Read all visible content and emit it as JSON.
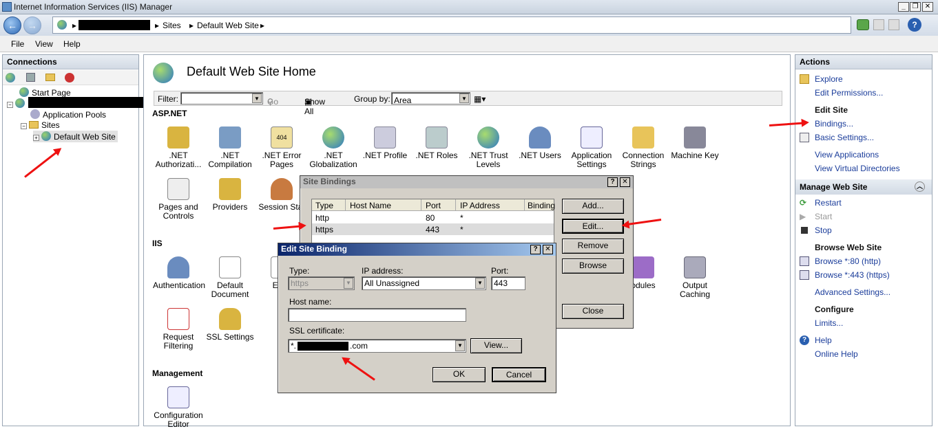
{
  "window": {
    "title": "Internet Information Services (IIS) Manager"
  },
  "address": {
    "segments": [
      "Sites",
      "Default Web Site"
    ]
  },
  "menu": [
    "File",
    "View",
    "Help"
  ],
  "connections": {
    "header": "Connections",
    "start_page": "Start Page",
    "app_pools": "Application Pools",
    "sites": "Sites",
    "default_site": "Default Web Site"
  },
  "main": {
    "title": "Default Web Site Home",
    "filter": {
      "label": "Filter:",
      "go": "Go",
      "show_all": "Show All",
      "group_by": "Group by:",
      "group_value": "Area"
    },
    "sections": {
      "aspnet": "ASP.NET",
      "iis": "IIS",
      "management": "Management"
    },
    "aspnet_features": [
      ".NET Authorizati...",
      ".NET Compilation",
      ".NET Error Pages",
      ".NET Globalization",
      ".NET Profile",
      ".NET Roles",
      ".NET Trust Levels",
      ".NET Users",
      "Application Settings",
      "Connection Strings",
      "Machine Key"
    ],
    "aspnet_row2": [
      "Pages and Controls",
      "Providers",
      "Session Stat"
    ],
    "iis_features": [
      "Authentication",
      "Default Document",
      "Error",
      "odules",
      "Output Caching"
    ],
    "iis_row2": [
      "Request Filtering",
      "SSL Settings"
    ],
    "management_features": [
      "Configuration Editor"
    ]
  },
  "site_bindings": {
    "title": "Site Bindings",
    "columns": [
      "Type",
      "Host Name",
      "Port",
      "IP Address",
      "Binding"
    ],
    "rows": [
      {
        "type": "http",
        "host": "",
        "port": "80",
        "ip": "*"
      },
      {
        "type": "https",
        "host": "",
        "port": "443",
        "ip": "*"
      }
    ],
    "buttons": {
      "add": "Add...",
      "edit": "Edit...",
      "remove": "Remove",
      "browse": "Browse",
      "close": "Close"
    }
  },
  "edit_binding": {
    "title": "Edit Site Binding",
    "type_label": "Type:",
    "type_value": "https",
    "ip_label": "IP address:",
    "ip_value": "All Unassigned",
    "port_label": "Port:",
    "port_value": "443",
    "host_label": "Host name:",
    "host_value": "",
    "cert_label": "SSL certificate:",
    "cert_prefix": "*.",
    "cert_suffix": ".com",
    "view": "View...",
    "ok": "OK",
    "cancel": "Cancel"
  },
  "actions": {
    "header": "Actions",
    "explore": "Explore",
    "edit_permissions": "Edit Permissions...",
    "edit_site": "Edit Site",
    "bindings": "Bindings...",
    "basic_settings": "Basic Settings...",
    "view_applications": "View Applications",
    "view_vdirs": "View Virtual Directories",
    "manage_site": "Manage Web Site",
    "restart": "Restart",
    "start": "Start",
    "stop": "Stop",
    "browse_site": "Browse Web Site",
    "browse_http": "Browse *:80 (http)",
    "browse_https": "Browse *:443 (https)",
    "advanced_settings": "Advanced Settings...",
    "configure": "Configure",
    "limits": "Limits...",
    "help": "Help",
    "online_help": "Online Help"
  }
}
